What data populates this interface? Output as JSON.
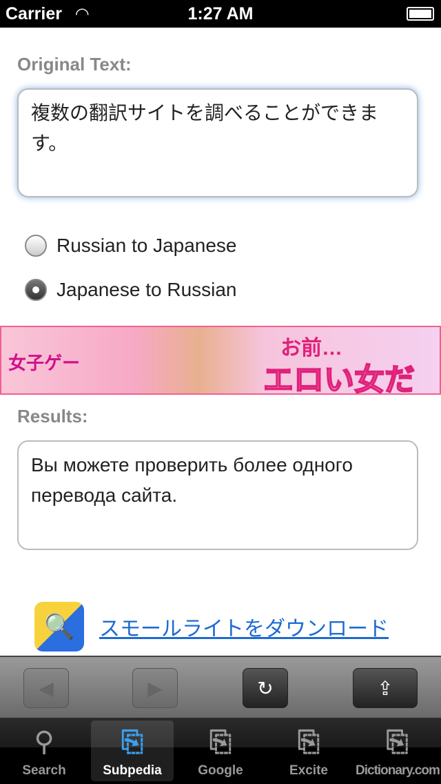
{
  "status": {
    "carrier": "Carrier",
    "time": "1:27 AM",
    "wifi_icon": "wifi-icon",
    "battery_icon": "battery-icon"
  },
  "original": {
    "label": "Original Text:",
    "value": "複数の翻訳サイトを調べることができます。"
  },
  "direction": {
    "options": [
      {
        "label": "Russian to Japanese",
        "selected": false
      },
      {
        "label": "Japanese to Russian",
        "selected": true
      }
    ]
  },
  "banner": {
    "text1": "女子ゲー",
    "text2": "お前…",
    "text3": "エロい女だな…"
  },
  "results": {
    "label": "Results:",
    "value": "Вы можете проверить более одного перевода сайта."
  },
  "download": {
    "link": "スモールライトをダウンロード"
  },
  "toolbar": {
    "back": "◀",
    "forward": "▶",
    "reload": "↻",
    "share": "⇪"
  },
  "tabs": [
    {
      "label": "Search",
      "icon": "search-icon"
    },
    {
      "label": "Subpedia",
      "icon": "translate-icon",
      "selected": true
    },
    {
      "label": "Google",
      "icon": "translate-icon"
    },
    {
      "label": "Excite",
      "icon": "translate-icon"
    },
    {
      "label": "Dictionary.com",
      "icon": "translate-icon"
    }
  ],
  "colors": {
    "accent": "#1d6ad0",
    "tab_selected": "#3aa0f0"
  }
}
